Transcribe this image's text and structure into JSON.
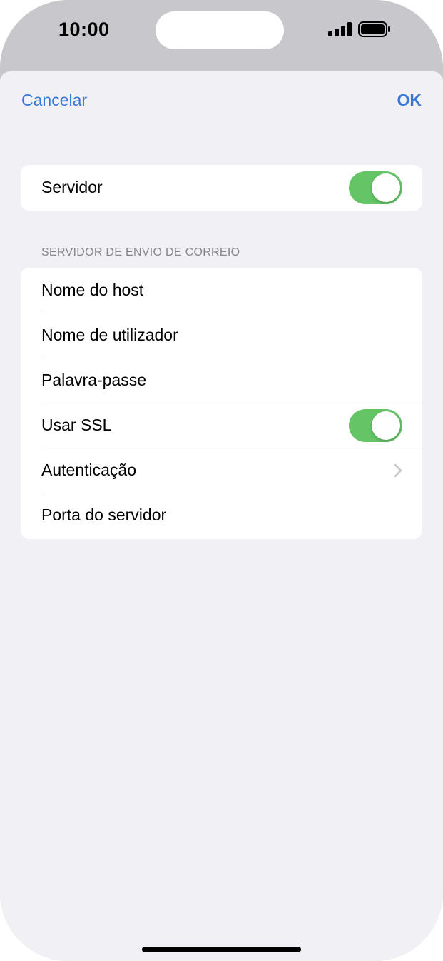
{
  "status_bar": {
    "time": "10:00",
    "icons": [
      "signal-icon",
      "battery-icon"
    ]
  },
  "nav": {
    "cancel_label": "Cancelar",
    "ok_label": "OK"
  },
  "server_card": {
    "label": "Servidor",
    "toggle_on": true
  },
  "outgoing": {
    "header": "SERVIDOR DE ENVIO DE CORREIO",
    "rows": [
      {
        "label": "Nome do host",
        "control": "text"
      },
      {
        "label": "Nome de utilizador",
        "control": "text"
      },
      {
        "label": "Palavra-passe",
        "control": "text"
      },
      {
        "label": "Usar SSL",
        "control": "toggle",
        "toggle_on": true
      },
      {
        "label": "Autenticação",
        "control": "chevron"
      },
      {
        "label": "Porta do servidor",
        "control": "text"
      }
    ]
  },
  "colors": {
    "accent": "#3478d6",
    "toggle_on": "#65c466",
    "background": "#f0f0f5"
  }
}
